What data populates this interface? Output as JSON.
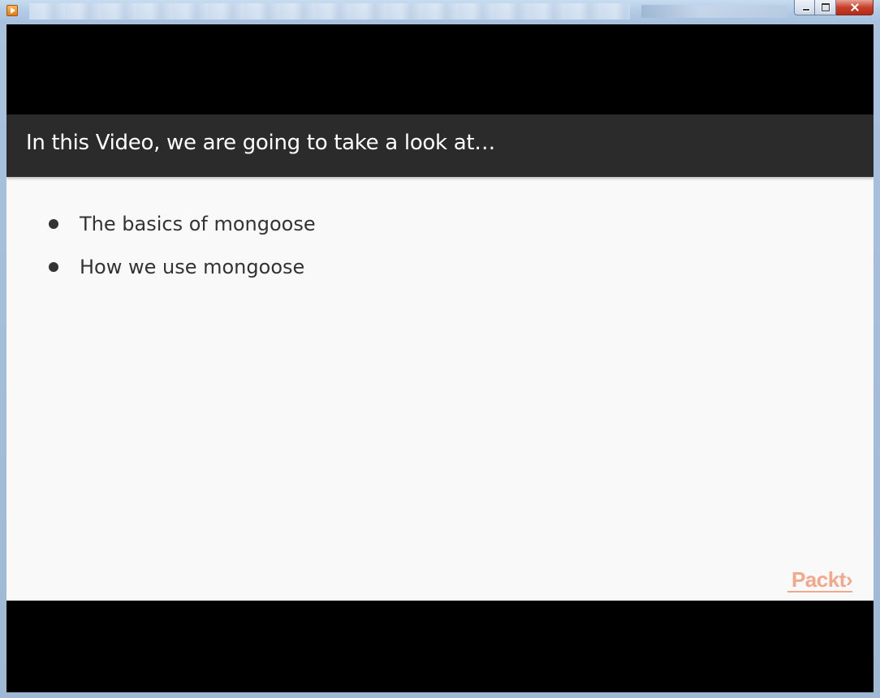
{
  "window": {
    "controls": {
      "minimize": "minimize",
      "maximize": "maximize",
      "close": "close"
    }
  },
  "slide": {
    "title": "In this Video, we are going to take a look at…",
    "bullets": [
      "The basics of mongoose",
      "How we use mongoose"
    ],
    "logo": "Packt›"
  },
  "colors": {
    "header_bg": "#2b2b2b",
    "slide_bg": "#f9f9f9",
    "logo": "#f3a78b",
    "text": "#333333"
  }
}
